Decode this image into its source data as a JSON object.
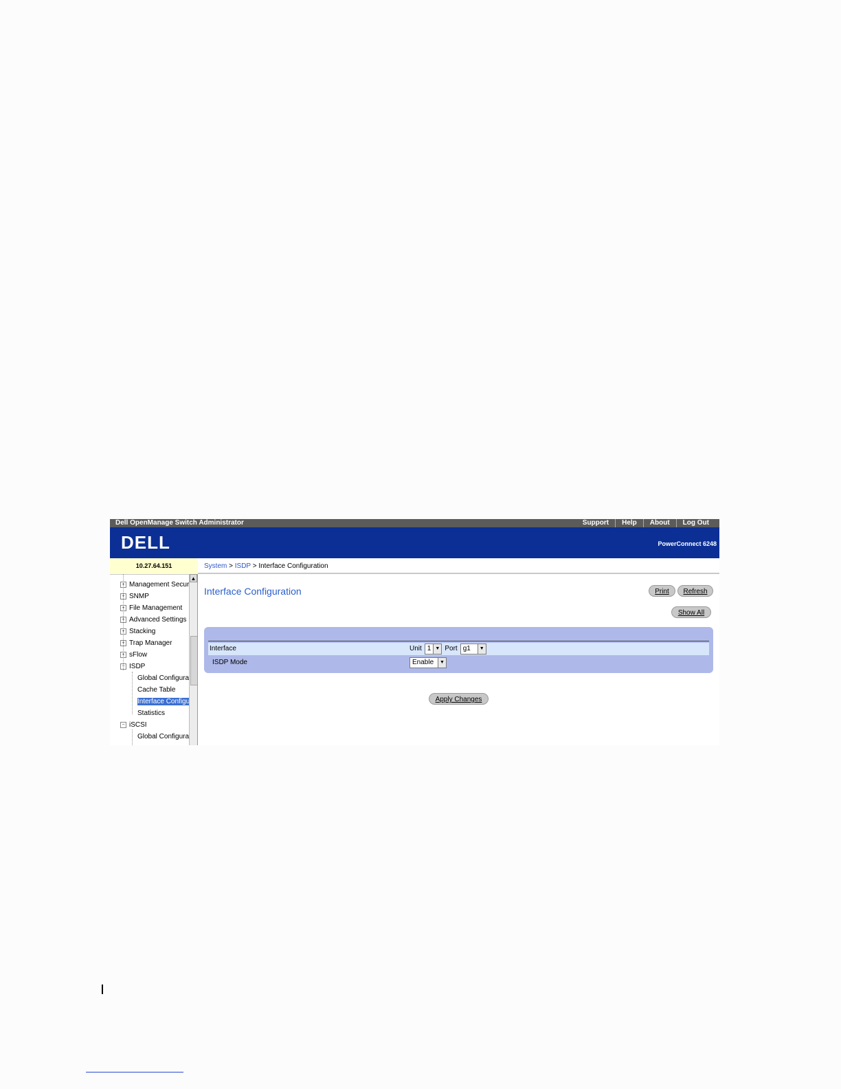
{
  "topbar": {
    "title": "Dell OpenManage Switch Administrator",
    "links": [
      "Support",
      "Help",
      "About",
      "Log Out"
    ]
  },
  "banner": {
    "logo": "DELL",
    "model": "PowerConnect 6248"
  },
  "address": "10.27.64.151",
  "breadcrumb": {
    "system": "System",
    "sep1": " > ",
    "isdp": "ISDP",
    "sep2": " > ",
    "current": "Interface Configuration"
  },
  "sidebar": {
    "items": [
      {
        "label": "Management Secur",
        "expander": "+"
      },
      {
        "label": "SNMP",
        "expander": "+"
      },
      {
        "label": "File Management",
        "expander": "+"
      },
      {
        "label": "Advanced Settings",
        "expander": "+"
      },
      {
        "label": "Stacking",
        "expander": "+"
      },
      {
        "label": "Trap Manager",
        "expander": "+"
      },
      {
        "label": "sFlow",
        "expander": "+"
      },
      {
        "label": "ISDP",
        "expander": "−"
      },
      {
        "label": "Global Configurat"
      },
      {
        "label": "Cache Table"
      },
      {
        "label": "Interface Configu"
      },
      {
        "label": "Statistics"
      },
      {
        "label": "iSCSI",
        "expander": "−"
      },
      {
        "label": "Global Configurat"
      }
    ]
  },
  "main": {
    "title": "Interface Configuration",
    "print": "Print",
    "refresh": "Refresh",
    "show_all": "Show All",
    "interface_label": "Interface",
    "unit_label": "Unit",
    "unit_value": "1",
    "port_label": "Port",
    "port_value": "g1",
    "isdp_label": "ISDP Mode",
    "isdp_value": "Enable",
    "apply": "Apply Changes"
  }
}
